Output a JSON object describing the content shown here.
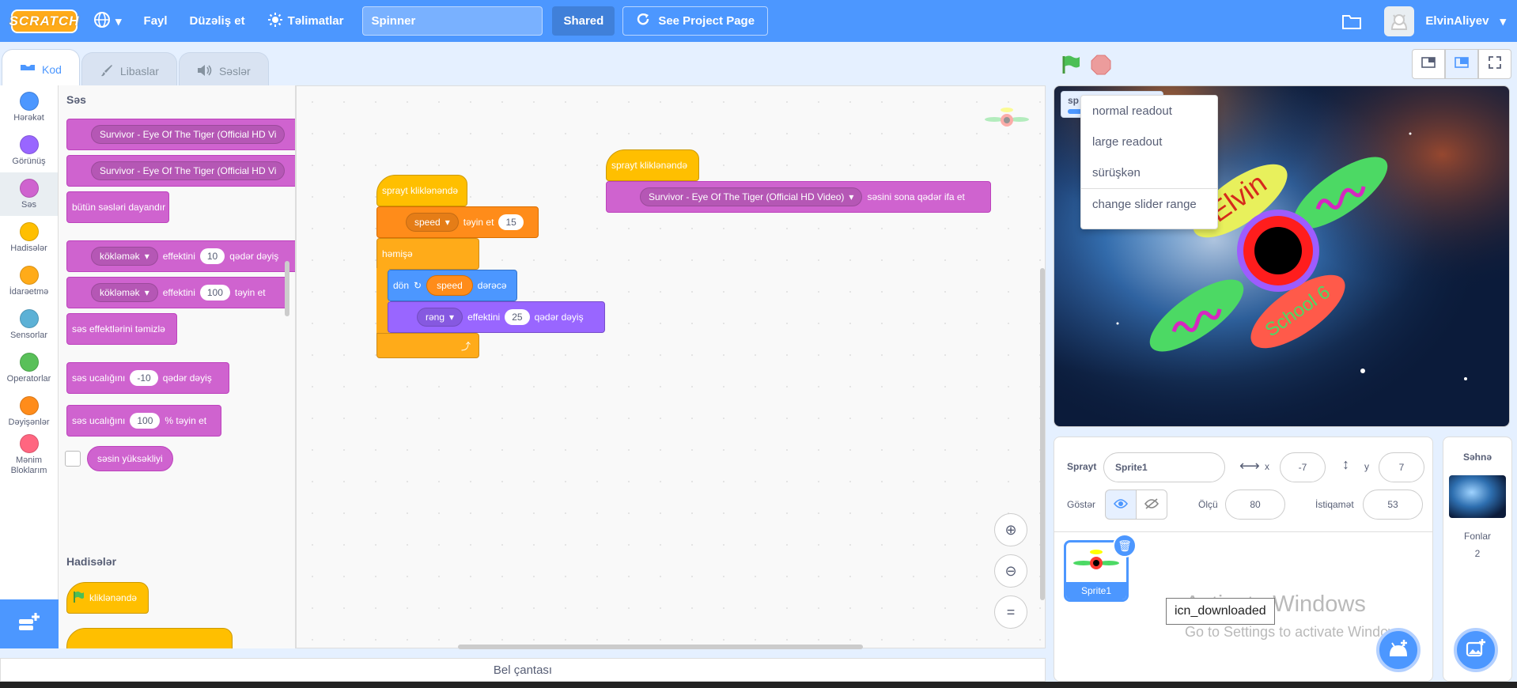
{
  "menu": {
    "logo": "SCRATCH",
    "file": "Fayl",
    "edit": "Düzəliş et",
    "tutorials": "Təlimatlar",
    "project_title": "Spinner",
    "shared": "Shared",
    "see_project": "See Project Page",
    "username": "ElvinAliyev"
  },
  "tabs": {
    "code": "Kod",
    "costumes": "Libaslar",
    "sounds": "Səslər"
  },
  "categories": [
    {
      "label": "Hərəkət",
      "color": "#4c97ff"
    },
    {
      "label": "Görünüş",
      "color": "#9966ff"
    },
    {
      "label": "Səs",
      "color": "#cf63cf"
    },
    {
      "label": "Hadisələr",
      "color": "#ffbf00"
    },
    {
      "label": "İdarəetmə",
      "color": "#ffab19"
    },
    {
      "label": "Sensorlar",
      "color": "#5cb1d6"
    },
    {
      "label": "Operatorlar",
      "color": "#59c059"
    },
    {
      "label": "Dəyişənlər",
      "color": "#ff8c1a"
    },
    {
      "label": "Mənim Bloklarım",
      "color": "#ff6680"
    }
  ],
  "palette": {
    "sound_heading": "Səs",
    "sound_name": "Survivor - Eye Of The Tiger (Official HD Video)",
    "play_until_done": "Survivor - Eye Of The Tiger (Official HD Vi",
    "start_sound": "Survivor - Eye Of The Tiger (Official HD Vi",
    "stop_all": "bütün səsləri dayandır",
    "effect_name": "kökləmək",
    "effect_label": "effektini",
    "change_by_val": "10",
    "change_by_suffix": "qədər dəyiş",
    "set_to_val": "100",
    "set_to_suffix": "təyin et",
    "clear_effects": "səs effektlərini təmizlə",
    "volume_label": "səs ucalığını",
    "volume_change_val": "-10",
    "volume_change_suffix": "qədər dəyiş",
    "volume_set_val": "100",
    "volume_set_suffix": "% təyin et",
    "loudness": "səsin yüksəkliyi",
    "events_heading": "Hadisələr",
    "when_flag": "kliklənəndə"
  },
  "scripts": {
    "when_clicked": "sprayt kliklənəndə",
    "set_var": "speed",
    "set_label": "təyin et",
    "set_val": "15",
    "forever": "həmişə",
    "turn": "dön",
    "turn_var": "speed",
    "turn_suffix": "dərəcə",
    "effect": "rəng",
    "effect_label": "effektini",
    "effect_val": "25",
    "effect_suffix": "qədər dəyiş",
    "when_clicked2": "sprayt kliklənəndə",
    "play_sound": "Survivor - Eye Of The Tiger (Official HD Video)",
    "play_suffix": "səsini sona qədər ifa et"
  },
  "bel": "Bel çantası",
  "stage": {
    "monitor_label": "sp",
    "context_menu": [
      "normal readout",
      "large readout",
      "sürüşkən",
      "change slider range"
    ],
    "text_elvin": "Elvin",
    "text_school": "School 6"
  },
  "sprite_info": {
    "sprite_label": "Sprayt",
    "sprite_name": "Sprite1",
    "x_label": "x",
    "x_val": "-7",
    "y_label": "y",
    "y_val": "7",
    "show_label": "Göstər",
    "size_label": "Ölçü",
    "size_val": "80",
    "direction_label": "İstiqamət",
    "direction_val": "53",
    "thumb_name": "Sprite1"
  },
  "stage_pane": {
    "title": "Səhnə",
    "backdrops_label": "Fonlar",
    "backdrops_count": "2"
  },
  "tooltip": "icn_downloaded",
  "watermark": {
    "line1": "Activate Windows",
    "line2": "Go to Settings to activate Windows."
  }
}
